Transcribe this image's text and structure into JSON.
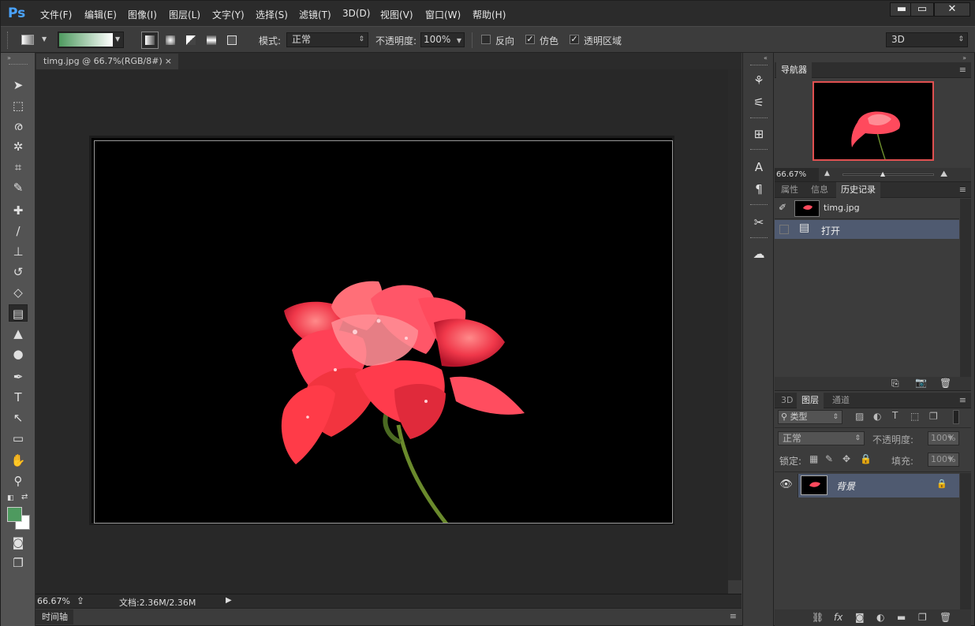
{
  "app": {
    "logo": "Ps"
  },
  "menu": [
    "文件(F)",
    "编辑(E)",
    "图像(I)",
    "图层(L)",
    "文字(Y)",
    "选择(S)",
    "滤镜(T)",
    "3D(D)",
    "视图(V)",
    "窗口(W)",
    "帮助(H)"
  ],
  "window_controls": {
    "minimize": "▬",
    "maximize": "▭",
    "close": "✕"
  },
  "options": {
    "mode_label": "模式:",
    "mode_value": "正常",
    "opacity_label": "不透明度:",
    "opacity_value": "100%",
    "reverse_label": "反向",
    "dither_label": "仿色",
    "transparency_label": "透明区域",
    "reverse_checked": false,
    "dither_checked": true,
    "transparency_checked": true,
    "workspace": "3D",
    "gradient_start": "#4e9a5f",
    "gradient_end": "#ffffff"
  },
  "document": {
    "tab_title": "timg.jpg @ 66.7%(RGB/8#)",
    "tab_close": "×",
    "zoom": "66.67%",
    "doc_info": "文档:2.36M/2.36M"
  },
  "timeline": {
    "label": "时间轴"
  },
  "navigator": {
    "tab": "导航器",
    "zoom": "66.67%"
  },
  "history_panel": {
    "tabs": [
      "属性",
      "信息",
      "历史记录"
    ],
    "snapshot_name": "timg.jpg",
    "items": [
      "打开"
    ]
  },
  "layers_panel": {
    "tabs": [
      "3D",
      "图层",
      "通道"
    ],
    "filter_label": "类型",
    "blend_mode": "正常",
    "opacity_label": "不透明度:",
    "opacity_value": "100%",
    "lock_label": "锁定:",
    "fill_label": "填充:",
    "fill_value": "100%",
    "layers": [
      {
        "name": "背景",
        "visible": true,
        "locked": true
      }
    ]
  },
  "colors": {
    "foreground": "#4e9a5f",
    "background": "#ffffff",
    "selection_highlight": "#4f5a70",
    "navigator_frame": "#e05050"
  }
}
